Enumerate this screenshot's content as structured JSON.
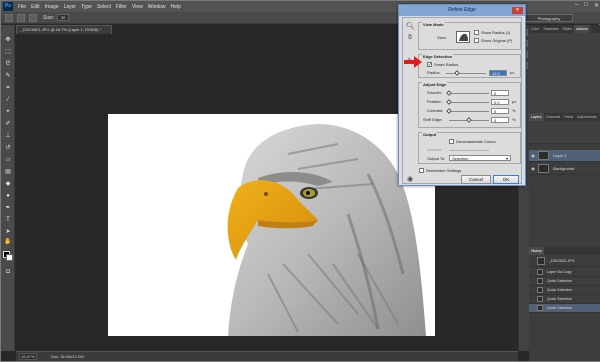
{
  "app": {
    "logo": "Ps"
  },
  "menu": [
    "File",
    "Edit",
    "Image",
    "Layer",
    "Type",
    "Select",
    "Filter",
    "View",
    "Window",
    "Help"
  ],
  "window_controls": [
    "–",
    "□",
    "✕"
  ],
  "options_bar": {
    "size_label": "Size:",
    "size_value": "30",
    "workspace": "Photography"
  },
  "document": {
    "tab_label": "_DSC9521.JPG @ 16.7% (Layer 1, RGB/8) *"
  },
  "status_bar": {
    "zoom": "16.67%",
    "doc_info": "Doc: 36.0M/12.0M"
  },
  "panels": {
    "top_tabs": [
      "Color",
      "Swatches",
      "Styles",
      "Actions"
    ],
    "layers_tabs": [
      "Layers",
      "Channels",
      "Paths",
      "Adjustments"
    ],
    "layers": [
      {
        "name": "Layer 1",
        "visible": true,
        "selected": true
      },
      {
        "name": "Background",
        "visible": true,
        "selected": false
      }
    ],
    "history_title": "History",
    "history_snapshot": "_DSC9521.JPG",
    "history_items": [
      "Layer Via Copy",
      "Quick Selection",
      "Quick Selection",
      "Quick Selection",
      "Quick Selection"
    ]
  },
  "dialog": {
    "title": "Refine Edge",
    "view_mode": {
      "title": "View Mode",
      "view_label": "View:",
      "show_radius": "Show Radius (J)",
      "show_original": "Show Original (P)"
    },
    "edge_detection": {
      "title": "Edge Detection",
      "smart_radius": "Smart Radius",
      "smart_radius_checked": true,
      "radius_label": "Radius:",
      "radius_value": "12.0",
      "radius_unit": "px"
    },
    "adjust_edge": {
      "title": "Adjust Edge",
      "rows": [
        {
          "label": "Smooth:",
          "value": "0",
          "unit": ""
        },
        {
          "label": "Feather:",
          "value": "0.0",
          "unit": "px"
        },
        {
          "label": "Contrast:",
          "value": "0",
          "unit": "%"
        },
        {
          "label": "Shift Edge:",
          "value": "0",
          "unit": "%"
        }
      ]
    },
    "output": {
      "title": "Output",
      "decontaminate": "Decontaminate Colors",
      "amount_label": "Amount:",
      "output_to_label": "Output To:",
      "output_to_value": "Selection"
    },
    "remember": "Remember Settings",
    "cancel": "Cancel",
    "ok": "OK"
  },
  "colors": {
    "ui_dark": "#282828",
    "ui_panel": "#3d3d3d",
    "selected": "#506178",
    "dialog": "#dcdcdc",
    "accent_blue": "#3a73c7",
    "arrow_red": "#e21b1b"
  }
}
